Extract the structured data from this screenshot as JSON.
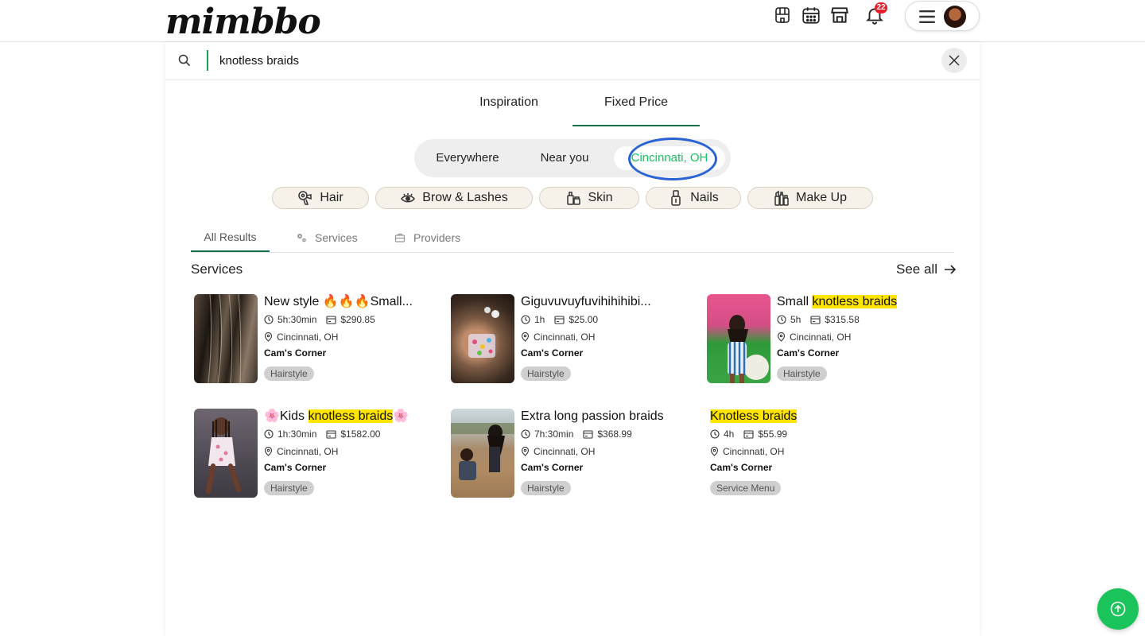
{
  "app": {
    "logo": "mimbbo",
    "notification_count": "22"
  },
  "search": {
    "value": "knotless braids"
  },
  "mode_tabs": [
    "Inspiration",
    "Fixed Price"
  ],
  "location_options": [
    "Everywhere",
    "Near you",
    "Cincinnati, OH"
  ],
  "categories": [
    {
      "label": "Hair",
      "icon": "hair-dryer-icon"
    },
    {
      "label": "Brow & Lashes",
      "icon": "eye-icon"
    },
    {
      "label": "Skin",
      "icon": "skincare-icon"
    },
    {
      "label": "Nails",
      "icon": "nail-polish-icon"
    },
    {
      "label": "Make Up",
      "icon": "makeup-icon"
    }
  ],
  "result_tabs": [
    {
      "label": "All Results"
    },
    {
      "label": "Services",
      "icon": "gears-icon"
    },
    {
      "label": "Providers",
      "icon": "briefcase-icon"
    }
  ],
  "section": {
    "title": "Services",
    "see_all": "See all"
  },
  "services": [
    {
      "title": "New style 🔥🔥🔥Small...",
      "duration": "5h:30min",
      "price": "$290.85",
      "location": "Cincinnati, OH",
      "provider": "Cam's Corner",
      "tag": "Hairstyle"
    },
    {
      "title": "Giguvuvuyfuvihihihibi...",
      "duration": "1h",
      "price": "$25.00",
      "location": "Cincinnati, OH",
      "provider": "Cam's Corner",
      "tag": "Hairstyle"
    },
    {
      "title_pre": "Small ",
      "title_hl": "knotless braids",
      "title_post": "",
      "duration": "5h",
      "price": "$315.58",
      "location": "Cincinnati, OH",
      "provider": "Cam's Corner",
      "tag": "Hairstyle"
    },
    {
      "title_pre": "🌸Kids ",
      "title_hl": "knotless braids",
      "title_post": "🌸",
      "duration": "1h:30min",
      "price": "$1582.00",
      "location": "Cincinnati, OH",
      "provider": "Cam's Corner",
      "tag": "Hairstyle"
    },
    {
      "title": "Extra long passion braids",
      "duration": "7h:30min",
      "price": "$368.99",
      "location": "Cincinnati, OH",
      "provider": "Cam's Corner",
      "tag": "Hairstyle"
    },
    {
      "title_hl": "Knotless braids",
      "duration": "4h",
      "price": "$55.99",
      "location": "Cincinnati, OH",
      "provider": "Cam's Corner",
      "tag": "Service Menu"
    }
  ],
  "colors": {
    "accent_green": "#14c45c",
    "tab_underline": "#14724a",
    "highlight": "#ffe500",
    "badge_red": "#e6202b",
    "annotation_ring": "#2a63d6"
  }
}
